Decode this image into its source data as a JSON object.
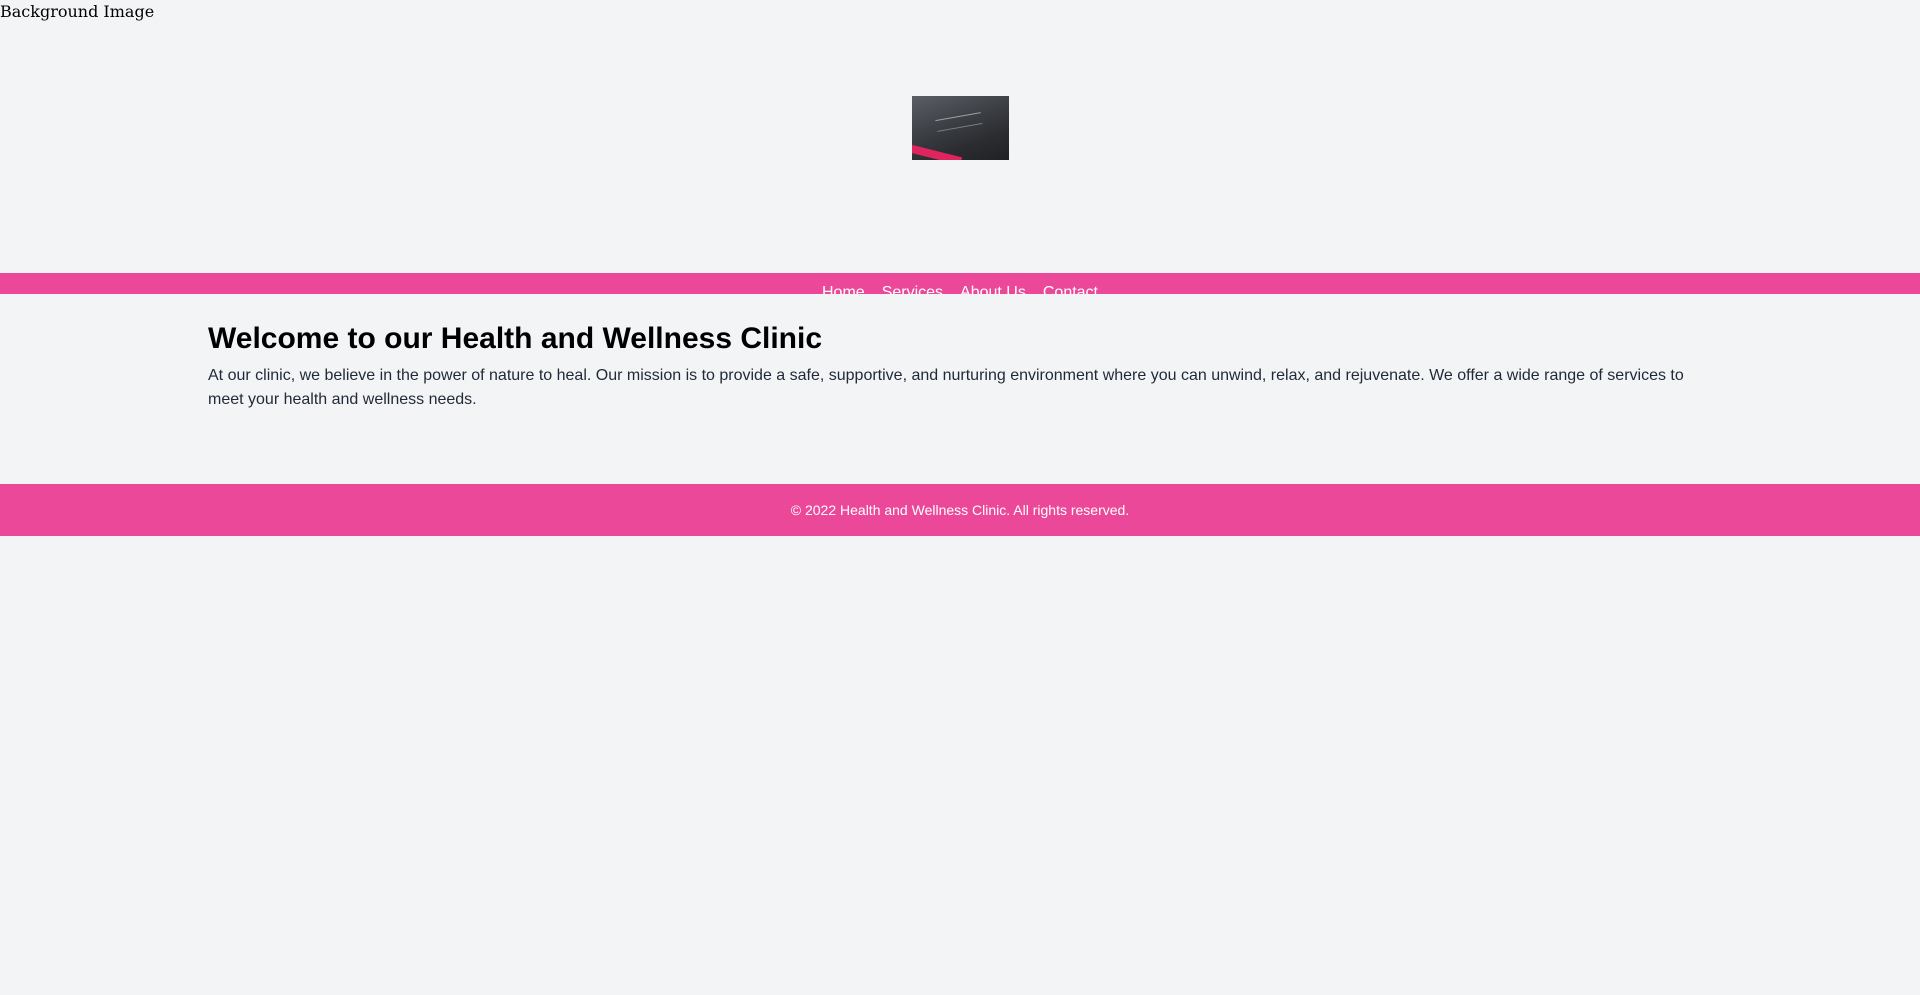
{
  "background_image_alt": "Background Image",
  "nav": {
    "items": [
      {
        "label": "Home"
      },
      {
        "label": "Services"
      },
      {
        "label": "About Us"
      },
      {
        "label": "Contact"
      }
    ]
  },
  "main": {
    "title": "Welcome to our Health and Wellness Clinic",
    "body": "At our clinic, we believe in the power of nature to heal. Our mission is to provide a safe, supportive, and nurturing environment where you can unwind, relax, and rejuvenate. We offer a wide range of services to meet your health and wellness needs."
  },
  "footer": {
    "copyright": "© 2022 Health and Wellness Clinic. All rights reserved."
  },
  "colors": {
    "accent": "#ec4899",
    "page_background": "#f3f4f6",
    "body_text": "#1f2937"
  }
}
